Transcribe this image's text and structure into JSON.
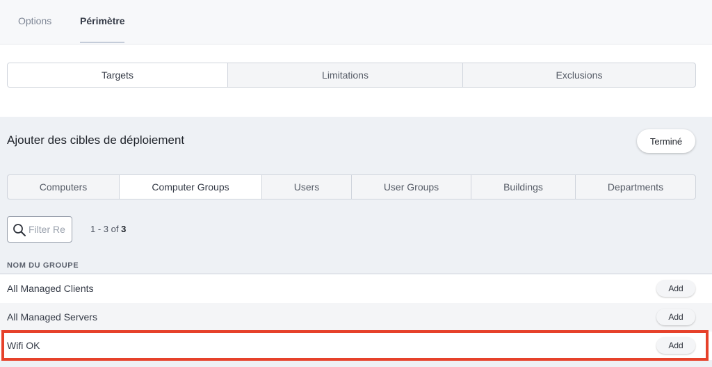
{
  "top_tabs": {
    "options": "Options",
    "perimetre": "Périmètre"
  },
  "scope_tabs": [
    "Targets",
    "Limitations",
    "Exclusions"
  ],
  "panel": {
    "title": "Ajouter des cibles de déploiement",
    "done_label": "Terminé"
  },
  "category_tabs": [
    "Computers",
    "Computer Groups",
    "Users",
    "User Groups",
    "Buildings",
    "Departments"
  ],
  "filter": {
    "placeholder": "Filter Re",
    "value": ""
  },
  "pagination": {
    "range": "1 - 3 of ",
    "total": "3"
  },
  "table": {
    "header": "NOM DU GROUPE",
    "rows": [
      {
        "name": "All Managed Clients",
        "action": "Add"
      },
      {
        "name": "All Managed Servers",
        "action": "Add"
      },
      {
        "name": "Wifi OK",
        "action": "Add"
      }
    ]
  },
  "colors": {
    "highlight": "#e6412a",
    "panel_bg": "#eef1f5"
  },
  "icons": {
    "filter": "search-icon"
  }
}
